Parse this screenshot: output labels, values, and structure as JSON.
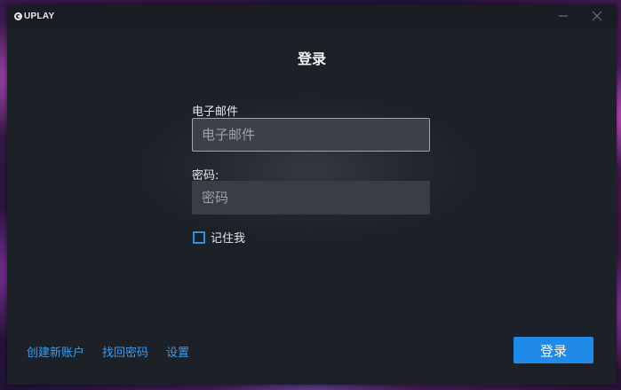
{
  "app": {
    "logo_text": "UPLAY",
    "window_controls": {
      "minimize_icon": "minimize-icon",
      "close_icon": "close-icon"
    }
  },
  "login": {
    "title": "登录",
    "email_label": "电子邮件",
    "email_placeholder": "电子邮件",
    "email_value": "",
    "password_label": "密码:",
    "password_placeholder": "密码",
    "password_value": "",
    "remember_label": "记住我",
    "remember_checked": false,
    "submit_label": "登录"
  },
  "footer": {
    "links": [
      {
        "label": "创建新账户"
      },
      {
        "label": "找回密码"
      },
      {
        "label": "设置"
      }
    ]
  },
  "colors": {
    "accent": "#1f8ae8",
    "link": "#3a9ff0",
    "window_bg": "#1c2027",
    "input_bg": "#3a3d43"
  }
}
